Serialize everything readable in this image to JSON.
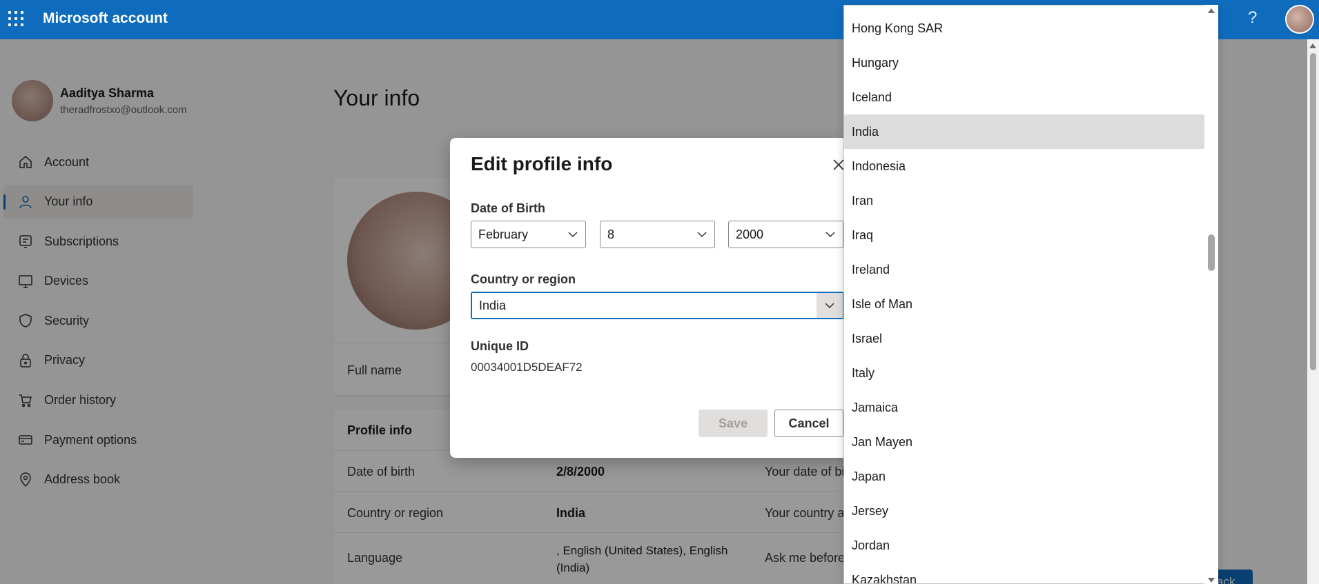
{
  "header": {
    "brand": "Microsoft account",
    "help_label": "?"
  },
  "sidebar": {
    "user_name": "Aaditya Sharma",
    "user_email": "theradfrostxo@outlook.com",
    "items": [
      {
        "label": "Account",
        "icon": "home-icon"
      },
      {
        "label": "Your info",
        "icon": "person-icon"
      },
      {
        "label": "Subscriptions",
        "icon": "subscriptions-icon"
      },
      {
        "label": "Devices",
        "icon": "monitor-icon"
      },
      {
        "label": "Security",
        "icon": "shield-icon"
      },
      {
        "label": "Privacy",
        "icon": "lock-icon"
      },
      {
        "label": "Order history",
        "icon": "cart-icon"
      },
      {
        "label": "Payment options",
        "icon": "credit-card-icon"
      },
      {
        "label": "Address book",
        "icon": "location-pin-icon"
      }
    ],
    "active_index": 1
  },
  "main": {
    "title": "Your info",
    "full_name_label": "Full name",
    "profile_info_title": "Profile info",
    "rows": [
      {
        "label": "Date of birth",
        "value": "2/8/2000",
        "desc": "Your date of bi"
      },
      {
        "label": "Country or region",
        "value": "India",
        "desc": "Your country an"
      },
      {
        "label": "Language",
        "value": ", English (United States), English (India)",
        "desc": "Ask me before"
      }
    ],
    "back_label": "ack"
  },
  "dialog": {
    "title": "Edit profile info",
    "dob_label": "Date of Birth",
    "month": "February",
    "day": "8",
    "year": "2000",
    "country_label": "Country or region",
    "country_value": "India",
    "uid_label": "Unique ID",
    "uid_value": "00034001D5DEAF72",
    "save_label": "Save",
    "cancel_label": "Cancel"
  },
  "dropdown": {
    "options": [
      "Hong Kong SAR",
      "Hungary",
      "Iceland",
      "India",
      "Indonesia",
      "Iran",
      "Iraq",
      "Ireland",
      "Isle of Man",
      "Israel",
      "Italy",
      "Jamaica",
      "Jan Mayen",
      "Japan",
      "Jersey",
      "Jordan",
      "Kazakhstan"
    ],
    "selected": "India"
  },
  "colors": {
    "accent": "#0f6cbd",
    "selected_option_bg": "#dcdcdc"
  }
}
